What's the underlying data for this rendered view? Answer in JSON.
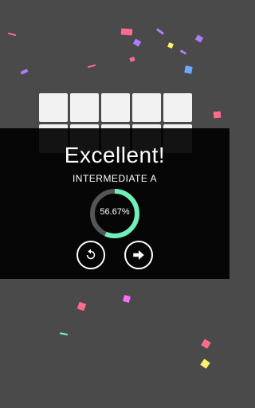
{
  "result": {
    "title": "Excellent!",
    "level_name": "INTERMEDIATE A",
    "progress_label": "56.67%",
    "progress_fraction": 0.5667
  },
  "buttons": {
    "restart_icon": "restart-icon",
    "next_icon": "arrow-right-icon"
  },
  "colors": {
    "background": "#4a4a4a",
    "overlay": "#000000",
    "progress_accent": "#6ff0b8",
    "progress_track": "#555555",
    "tile": "#f2f2f2"
  },
  "board": {
    "columns": 5,
    "tile_count": 10
  }
}
